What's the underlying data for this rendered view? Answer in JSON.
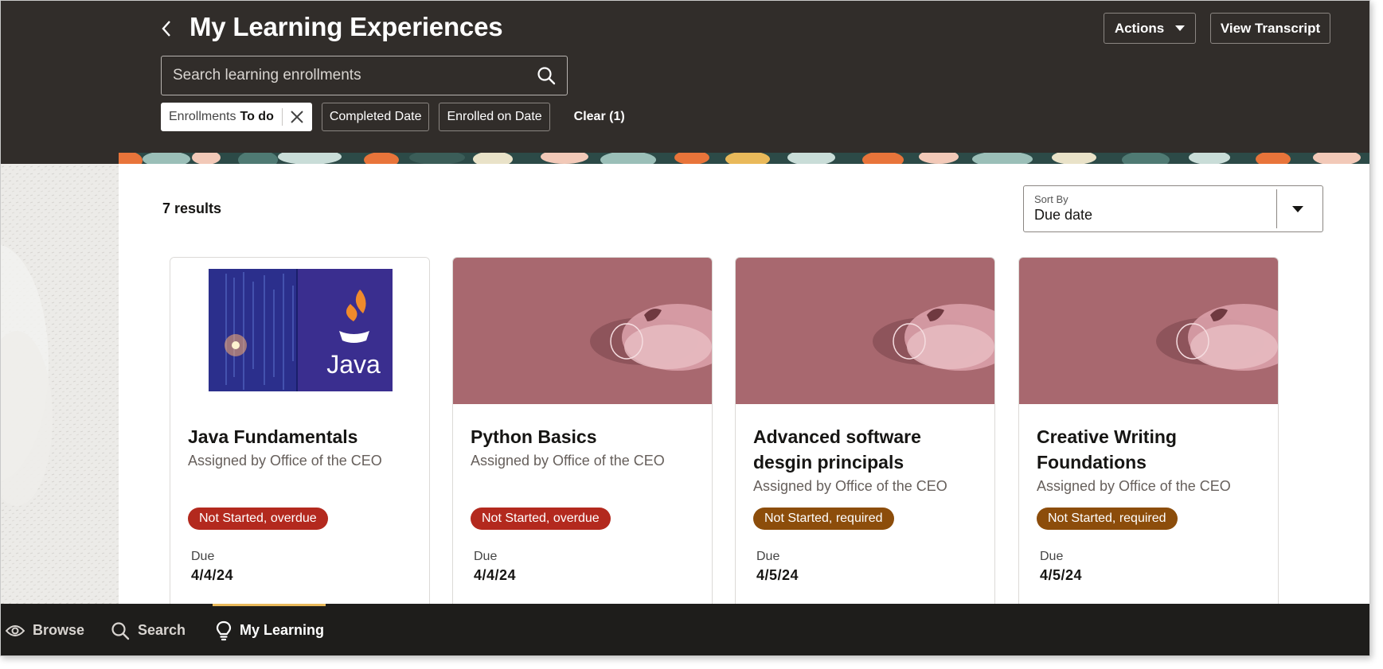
{
  "header": {
    "title": "My Learning Experiences",
    "actions_label": "Actions",
    "transcript_label": "View Transcript"
  },
  "search": {
    "placeholder": "Search learning enrollments",
    "value": ""
  },
  "filters": {
    "active_chip": {
      "label": "Enrollments",
      "value": "To do"
    },
    "chips": [
      "Completed Date",
      "Enrolled on Date"
    ],
    "clear_label": "Clear (1)"
  },
  "results": {
    "count_label": "7 results"
  },
  "sort": {
    "label": "Sort By",
    "value": "Due date"
  },
  "cards": [
    {
      "title": "Java Fundamentals",
      "subtitle": "Assigned by Office of the CEO",
      "status": "Not Started, overdue",
      "status_color": "#b3291e",
      "due_label": "Due",
      "due": "4/4/24",
      "image_text": "Java"
    },
    {
      "title": "Python Basics",
      "subtitle": "Assigned by Office of the CEO",
      "status": "Not Started, overdue",
      "status_color": "#b3291e",
      "due_label": "Due",
      "due": "4/4/24"
    },
    {
      "title": "Advanced software desgin principals",
      "subtitle": "Assigned by Office of the CEO",
      "status": "Not Started, required",
      "status_color": "#8c4d0b",
      "due_label": "Due",
      "due": "4/5/24"
    },
    {
      "title": "Creative Writing Foundations",
      "subtitle": "Assigned by Office of the CEO",
      "status": "Not Started, required",
      "status_color": "#8c4d0b",
      "due_label": "Due",
      "due": "4/5/24"
    }
  ],
  "bottom_nav": {
    "items": [
      {
        "label": "Browse",
        "icon": "eye-icon"
      },
      {
        "label": "Search",
        "icon": "search-icon"
      },
      {
        "label": "My Learning",
        "icon": "lightbulb-icon",
        "active": true
      }
    ],
    "active_indicator_color": "#e9b95a"
  },
  "colors": {
    "header_bg": "#312d2a",
    "card_image_bg": "#a8686f",
    "nav_bg": "#1e1d1b"
  }
}
